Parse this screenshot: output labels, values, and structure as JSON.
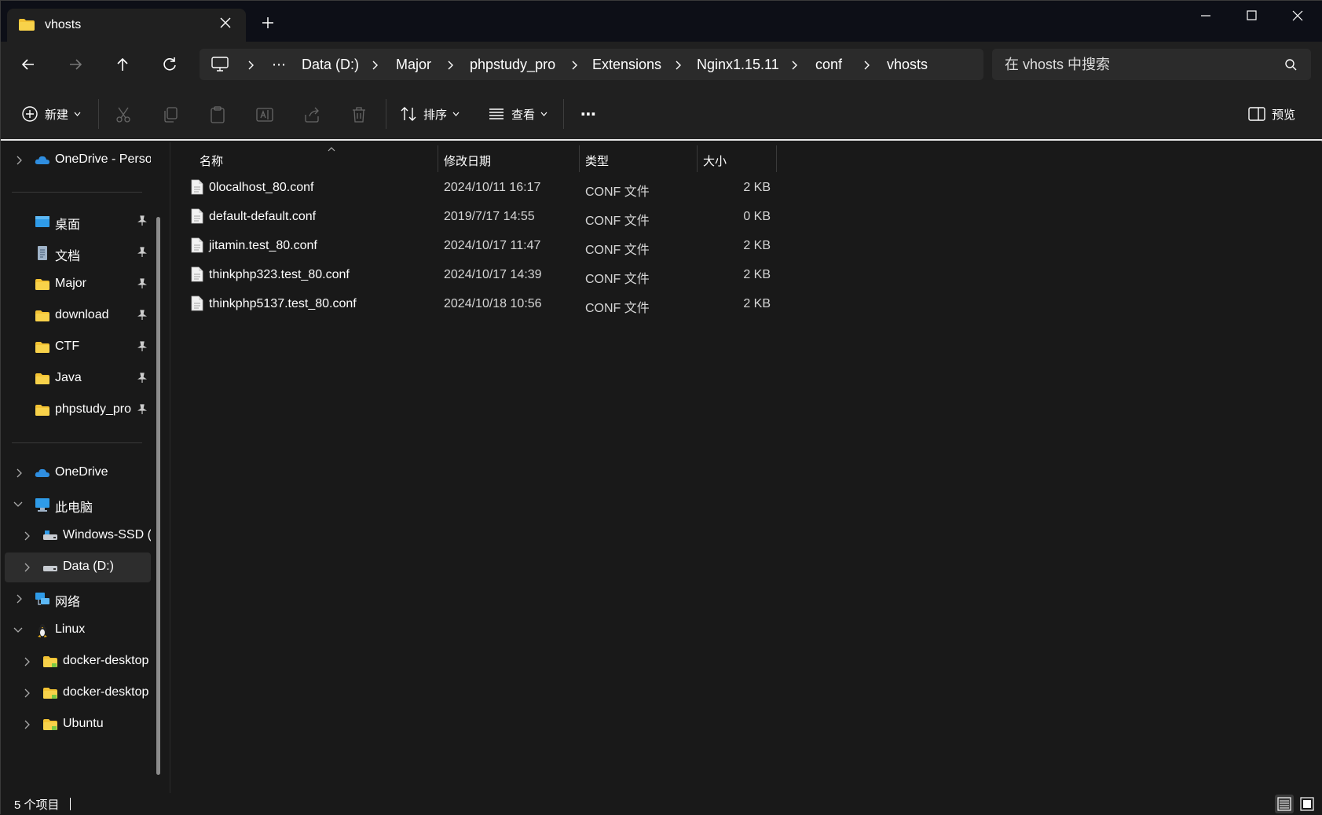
{
  "window": {
    "tab_title": "vhosts",
    "colors": {
      "accent": "#0a84ff",
      "folder": "#f3c233",
      "background": "#191919",
      "chrome": "#202020"
    }
  },
  "nav": {
    "breadcrumb": [
      {
        "label": "Data (D:)"
      },
      {
        "label": "Major"
      },
      {
        "label": "phpstudy_pro"
      },
      {
        "label": "Extensions"
      },
      {
        "label": "Nginx1.15.11"
      },
      {
        "label": "conf"
      },
      {
        "label": "vhosts"
      }
    ],
    "overflow_label": "⋯",
    "search_placeholder": "在 vhosts 中搜索"
  },
  "toolbar": {
    "new_label": "新建",
    "sort_label": "排序",
    "view_label": "查看",
    "more_label": "⋯",
    "preview_label": "预览"
  },
  "sidebar": {
    "items": [
      {
        "label": "OneDrive - Perso",
        "icon": "onedrive-icon"
      },
      {
        "label": "桌面",
        "icon": "desktop-icon",
        "pinned": true
      },
      {
        "label": "文档",
        "icon": "documents-icon",
        "pinned": true
      },
      {
        "label": "Major",
        "icon": "folder-icon",
        "pinned": true
      },
      {
        "label": "download",
        "icon": "folder-icon",
        "pinned": true
      },
      {
        "label": "CTF",
        "icon": "folder-icon",
        "pinned": true
      },
      {
        "label": "Java",
        "icon": "folder-icon",
        "pinned": true
      },
      {
        "label": "phpstudy_pro",
        "icon": "folder-icon",
        "pinned": true
      },
      {
        "label": "OneDrive",
        "icon": "onedrive-icon"
      },
      {
        "label": "此电脑",
        "icon": "computer-icon",
        "expanded": true
      },
      {
        "label": "Windows-SSD (",
        "icon": "drive-icon"
      },
      {
        "label": "Data (D:)",
        "icon": "drive-icon",
        "selected": true
      },
      {
        "label": "网络",
        "icon": "network-icon"
      },
      {
        "label": "Linux",
        "icon": "linux-icon",
        "expanded": true
      },
      {
        "label": "docker-desktop",
        "icon": "folder-icon"
      },
      {
        "label": "docker-desktop",
        "icon": "folder-icon"
      },
      {
        "label": "Ubuntu",
        "icon": "folder-icon"
      }
    ]
  },
  "files": {
    "columns": [
      "名称",
      "修改日期",
      "类型",
      "大小"
    ],
    "rows": [
      {
        "name": "0localhost_80.conf",
        "date": "2024/10/11 16:17",
        "type": "CONF 文件",
        "size": "2 KB"
      },
      {
        "name": "default-default.conf",
        "date": "2019/7/17 14:55",
        "type": "CONF 文件",
        "size": "0 KB"
      },
      {
        "name": "jitamin.test_80.conf",
        "date": "2024/10/17 11:47",
        "type": "CONF 文件",
        "size": "2 KB"
      },
      {
        "name": "thinkphp323.test_80.conf",
        "date": "2024/10/17 14:39",
        "type": "CONF 文件",
        "size": "2 KB"
      },
      {
        "name": "thinkphp5137.test_80.conf",
        "date": "2024/10/18 10:56",
        "type": "CONF 文件",
        "size": "2 KB"
      }
    ]
  },
  "status": {
    "count_label": "5 个项目"
  }
}
